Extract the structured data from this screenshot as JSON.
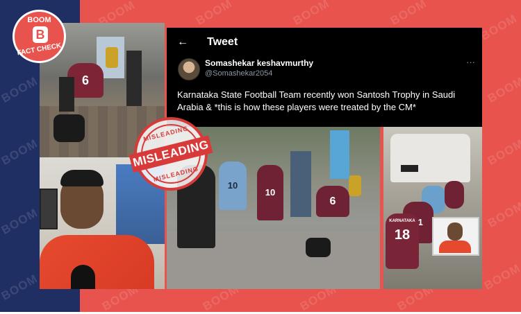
{
  "brand": {
    "logo_top": "BOOM",
    "logo_letter": "B",
    "logo_bottom": "FACT CHECK",
    "watermark": "BOOM",
    "colors": {
      "navy": "#1f2f63",
      "red": "#e8534d",
      "stamp_red": "#d83a3a"
    }
  },
  "tweet": {
    "back_icon": "←",
    "header_title": "Tweet",
    "display_name": "Somashekar keshavmurthy",
    "handle": "@Somashekar2054",
    "more_icon": "···",
    "text": "Karnataka State Football Team recently won Santosh Trophy in Saudi Arabia & *this is how these players were treated by the CM*"
  },
  "stamp": {
    "top": "MISLEADING",
    "band": "MISLEADING",
    "bottom": "MISLEADING"
  },
  "photos": {
    "jersey_number_left": "6",
    "jersey_numbers_middle": [
      "6",
      "10",
      "10"
    ],
    "jersey_numbers_right": [
      "18",
      "11"
    ],
    "jersey_text_right": "KARNATAKA"
  }
}
